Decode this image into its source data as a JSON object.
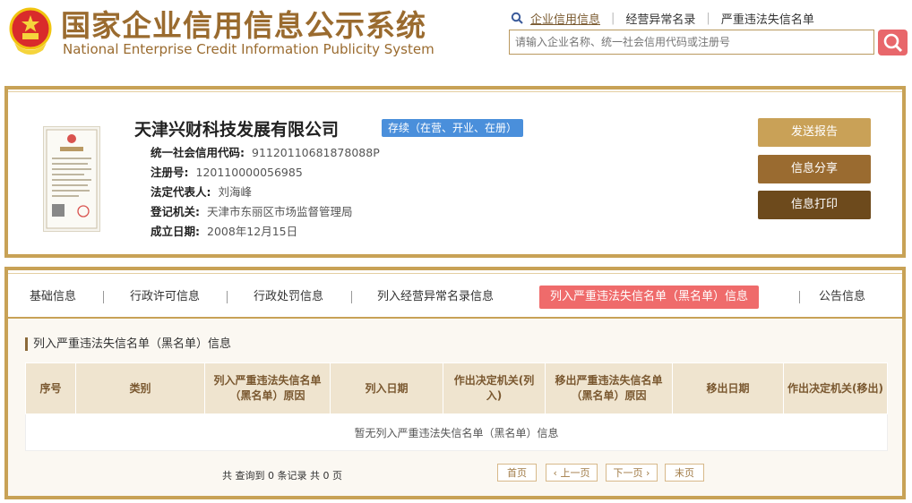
{
  "header": {
    "title_cn": "国家企业信用信息公示系统",
    "title_en": "National Enterprise Credit Information Publicity System",
    "links": [
      "企业信用信息",
      "经营异常名录",
      "严重违法失信名单"
    ],
    "search_placeholder": "请输入企业名称、统一社会信用代码或注册号"
  },
  "company": {
    "name": "天津兴财科技发展有限公司",
    "status": "存续（在营、开业、在册）",
    "license_label": "营业执照",
    "fields": [
      {
        "label": "统一社会信用代码:",
        "value": "91120110681878088P"
      },
      {
        "label": "注册号:",
        "value": "120110000056985"
      },
      {
        "label": "法定代表人:",
        "value": "刘海峰"
      },
      {
        "label": "登记机关:",
        "value": "天津市东丽区市场监督管理局"
      },
      {
        "label": "成立日期:",
        "value": "2008年12月15日"
      }
    ],
    "actions": [
      "发送报告",
      "信息分享",
      "信息打印"
    ]
  },
  "tabs": [
    "基础信息",
    "行政许可信息",
    "行政处罚信息",
    "列入经营异常名录信息",
    "列入严重违法失信名单（黑名单）信息",
    "公告信息"
  ],
  "active_tab": 4,
  "section": {
    "title": "列入严重违法失信名单（黑名单）信息",
    "columns": [
      "序号",
      "类别",
      "列入严重违法失信名单（黑名单）原因",
      "列入日期",
      "作出决定机关(列入)",
      "移出严重违法失信名单（黑名单）原因",
      "移出日期",
      "作出决定机关(移出)"
    ],
    "empty_text": "暂无列入严重违法失信名单（黑名单）信息"
  },
  "pagination": {
    "summary": "共 查询到 0 条记录 共 0 页",
    "first": "首页",
    "prev": "‹ 上一页",
    "next": "下一页 ›",
    "last": "末页"
  },
  "colors": {
    "gold": "#c8a256",
    "brown_text": "#9a6b2f",
    "active_tab": "#ef6b6b",
    "status_blue": "#4a8fdb",
    "search_btn": "#e8676b"
  }
}
